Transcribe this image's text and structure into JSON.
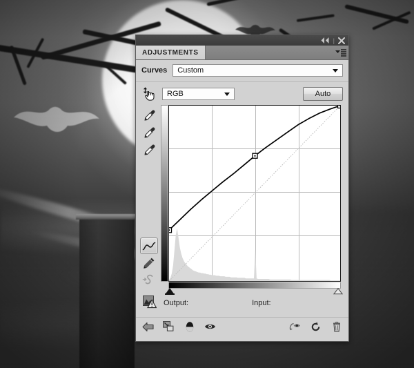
{
  "background": {
    "description": "grayscale halloween night scene",
    "elements": [
      "full-moon",
      "bare-tree-branches",
      "flying-bats",
      "fog",
      "stone-pillar"
    ]
  },
  "panel": {
    "titlebar": {
      "collapse_icon": "collapse-to-icons",
      "collapse_glyph": "◀◀",
      "close_icon": "close",
      "close_glyph": "✕",
      "separator": "|"
    },
    "tab": {
      "label": "ADJUSTMENTS",
      "menu_icon": "panel-menu"
    },
    "preset_row": {
      "label": "Curves",
      "select_value": "Custom",
      "select_placeholder": "Custom",
      "caret_icon": "chevron-down-icon"
    },
    "channel_row": {
      "targeted_adjustment_icon": "targeted-adjustment-hand",
      "channel_value": "RGB",
      "auto_label": "Auto"
    },
    "tools": [
      {
        "name": "eyedropper-black-point",
        "icon": "eyedropper-icon"
      },
      {
        "name": "eyedropper-gray-point",
        "icon": "eyedropper-icon"
      },
      {
        "name": "eyedropper-white-point",
        "icon": "eyedropper-icon"
      },
      {
        "name": "curve-point-tool",
        "icon": "curve-icon",
        "selected": true
      },
      {
        "name": "pencil-draw-curve-tool",
        "icon": "pencil-icon"
      },
      {
        "name": "smooth-curve-tool",
        "icon": "smooth-curve-icon"
      }
    ],
    "io_row": {
      "warning_icon": "histogram-warning-icon",
      "output_label": "Output:",
      "output_value": "",
      "input_label": "Input:",
      "input_value": ""
    },
    "footer": {
      "left": [
        {
          "name": "return-to-adjustment-list",
          "icon": "back-arrow-icon",
          "glyph": "◁"
        },
        {
          "name": "clip-to-layer",
          "icon": "clip-to-layer-icon"
        },
        {
          "name": "toggle-layer-mask",
          "icon": "mask-icon"
        },
        {
          "name": "toggle-layer-visibility",
          "icon": "eye-icon"
        }
      ],
      "right": [
        {
          "name": "preview-previous-state",
          "icon": "preview-previous-state-icon"
        },
        {
          "name": "reset-adjustment",
          "icon": "reset-icon",
          "glyph": "↺"
        },
        {
          "name": "delete-adjustment-layer",
          "icon": "trash-icon"
        }
      ]
    },
    "colors": {
      "panel_bg": "#d2d2d2",
      "titlebar": "#3c3c3c",
      "tab_active": "#d8d8d8",
      "tab_bar": "#8c8c8c",
      "grid_line": "#b9b9b9",
      "curve_line": "#000000",
      "baseline_diagonal": "#bdbdbd",
      "histogram": "#d9d9d9"
    }
  },
  "chart_data": {
    "type": "line",
    "title": "Curves (RGB)",
    "xlabel": "Input",
    "ylabel": "Output",
    "xlim": [
      0,
      255
    ],
    "ylim": [
      0,
      255
    ],
    "grid": true,
    "grid_divisions": 4,
    "legend": "none",
    "series": [
      {
        "name": "Baseline (identity)",
        "style": "dotted-diagonal",
        "color": "#bdbdbd",
        "x": [
          0,
          255
        ],
        "y": [
          0,
          255
        ]
      },
      {
        "name": "RGB curve",
        "style": "solid",
        "color": "#000000",
        "control_points": [
          {
            "input": 0,
            "output": 74
          },
          {
            "input": 128,
            "output": 182
          },
          {
            "input": 255,
            "output": 255
          }
        ],
        "x": [
          0,
          16,
          32,
          48,
          64,
          80,
          96,
          112,
          128,
          144,
          160,
          176,
          192,
          208,
          224,
          240,
          255
        ],
        "y": [
          74,
          89,
          104,
          118,
          131,
          144,
          156,
          169,
          182,
          194,
          205,
          216,
          227,
          236,
          244,
          250,
          255
        ]
      }
    ],
    "histogram": {
      "name": "image-histogram",
      "color": "#d9d9d9",
      "bins": [
        2,
        6,
        14,
        30,
        58,
        88,
        100,
        82,
        64,
        52,
        44,
        38,
        34,
        31,
        28,
        26,
        24,
        22,
        20,
        19,
        18,
        17,
        16,
        16,
        15,
        15,
        14,
        14,
        13,
        13,
        12,
        12,
        11,
        11,
        11,
        10,
        10,
        10,
        9,
        9,
        9,
        9,
        8,
        8,
        8,
        8,
        7,
        7,
        7,
        7,
        7,
        6,
        6,
        6,
        6,
        6,
        6,
        5,
        5,
        5,
        5,
        5,
        5,
        5,
        60,
        5,
        4,
        4,
        4,
        4,
        4,
        4,
        4,
        4,
        4,
        3,
        3,
        3,
        3,
        3,
        3,
        3,
        3,
        3,
        3,
        3,
        3,
        3,
        3,
        3,
        3,
        2,
        2,
        2,
        2,
        2,
        2,
        2,
        2,
        2,
        2,
        2,
        2,
        2,
        2,
        2,
        2,
        2,
        2,
        2,
        2,
        2,
        2,
        2,
        2,
        2,
        2,
        2,
        2,
        2,
        1,
        1,
        1,
        1,
        1,
        1,
        1,
        1
      ]
    },
    "sliders": {
      "black_point": 0,
      "white_point": 255,
      "black_marker": "filled-triangle",
      "white_marker": "outline-triangle"
    }
  }
}
